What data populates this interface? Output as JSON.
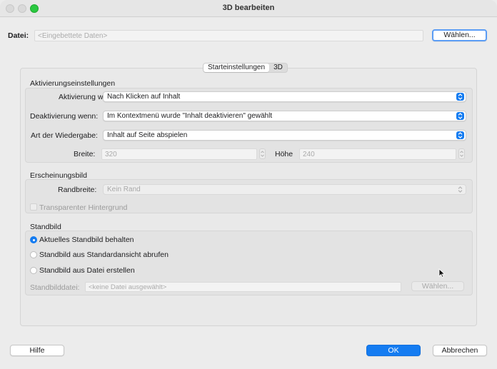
{
  "window": {
    "title": "3D bearbeiten"
  },
  "file": {
    "label": "Datei:",
    "value": "<Eingebettete Daten>",
    "choose_label": "Wählen..."
  },
  "tabs": [
    {
      "label": "Starteinstellungen",
      "active": true
    },
    {
      "label": "3D",
      "active": false
    }
  ],
  "activation": {
    "title": "Aktivierungseinstellungen",
    "activate_label": "Aktivierung wenn:",
    "activate_value": "Nach Klicken auf Inhalt",
    "deactivate_label": "Deaktivierung wenn:",
    "deactivate_value": "Im Kontextmenü wurde \"Inhalt deaktivieren\" gewählt",
    "playback_label": "Art der Wiedergabe:",
    "playback_value": "Inhalt auf Seite abspielen",
    "width_label": "Breite:",
    "width_value": "320",
    "height_label": "Höhe",
    "height_value": "240"
  },
  "appearance": {
    "title": "Erscheinungsbild",
    "border_label": "Randbreite:",
    "border_value": "Kein Rand",
    "transparent_label": "Transparenter Hintergrund"
  },
  "poster": {
    "title": "Standbild",
    "options": [
      {
        "label": "Aktuelles Standbild behalten",
        "selected": true
      },
      {
        "label": "Standbild aus Standardansicht abrufen",
        "selected": false
      },
      {
        "label": "Standbild aus Datei erstellen",
        "selected": false
      }
    ],
    "file_label": "Standbilddatei:",
    "file_value": "<keine Datei ausgewählt>",
    "choose_label": "Wählen..."
  },
  "footer": {
    "help": "Hilfe",
    "ok": "OK",
    "cancel": "Abbrechen"
  },
  "colors": {
    "accent": "#157cf1",
    "focus_ring": "#5b9df5",
    "maximize": "#2ac840"
  }
}
